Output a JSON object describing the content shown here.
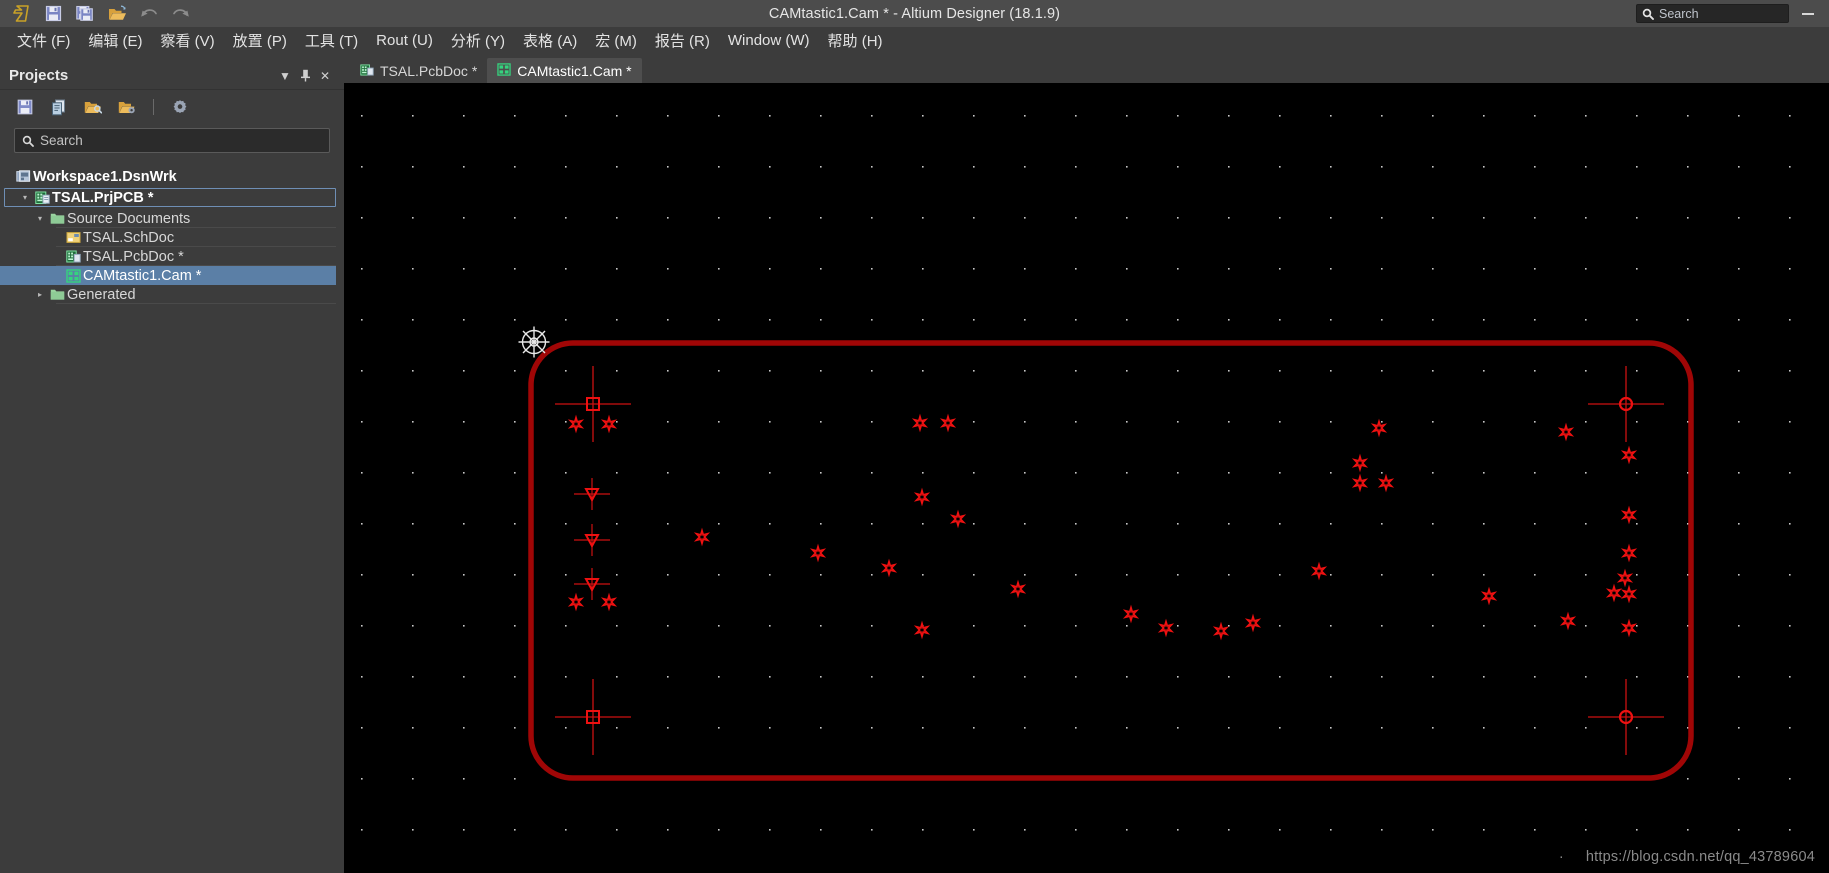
{
  "window": {
    "title": "CAMtastic1.Cam * - Altium Designer (18.1.9)",
    "minimize_label": "–"
  },
  "title_toolbar": {
    "buttons": [
      {
        "name": "altium-logo-icon",
        "label": "Altium"
      },
      {
        "name": "save-icon",
        "label": "Save"
      },
      {
        "name": "save-all-icon",
        "label": "Save All"
      },
      {
        "name": "open-folder-icon",
        "label": "Open"
      },
      {
        "name": "undo-icon",
        "label": "Undo"
      },
      {
        "name": "redo-icon",
        "label": "Redo"
      }
    ]
  },
  "search": {
    "placeholder": "Search",
    "icon": "search-icon"
  },
  "menubar": {
    "items": [
      {
        "label": "文件 (F)",
        "text": "文件",
        "key": "F"
      },
      {
        "label": "编辑 (E)",
        "text": "编辑",
        "key": "E"
      },
      {
        "label": "察看 (V)",
        "text": "察看",
        "key": "V"
      },
      {
        "label": "放置 (P)",
        "text": "放置",
        "key": "P"
      },
      {
        "label": "工具 (T)",
        "text": "工具",
        "key": "T"
      },
      {
        "label": "Rout (U)",
        "text": "Rout",
        "key": "U"
      },
      {
        "label": "分析 (Y)",
        "text": "分析",
        "key": "Y"
      },
      {
        "label": "表格 (A)",
        "text": "表格",
        "key": "A"
      },
      {
        "label": "宏 (M)",
        "text": "宏",
        "key": "M"
      },
      {
        "label": "报告 (R)",
        "text": "报告",
        "key": "R"
      },
      {
        "label": "Window (W)",
        "text": "Window",
        "key": "W"
      },
      {
        "label": "帮助 (H)",
        "text": "帮助",
        "key": "H"
      }
    ]
  },
  "projects_panel": {
    "title": "Projects",
    "header_icons": [
      {
        "name": "chevron-down-icon",
        "glyph": "▼"
      },
      {
        "name": "pin-icon",
        "glyph": "⚑"
      },
      {
        "name": "close-icon",
        "glyph": "✕"
      }
    ],
    "toolbar": [
      {
        "name": "save-project-icon",
        "label": "Save"
      },
      {
        "name": "documents-icon",
        "label": "Documents"
      },
      {
        "name": "open-project-icon",
        "label": "Open Project"
      },
      {
        "name": "project-options-icon",
        "label": "Project Options"
      },
      {
        "name": "panel-settings-icon",
        "label": "Settings"
      }
    ],
    "search": {
      "placeholder": "Search"
    },
    "tree": [
      {
        "label": "Workspace1.DsnWrk",
        "icon": "workspace-icon",
        "indent": 0,
        "expander": "none",
        "style": "root",
        "underline": false
      },
      {
        "label": "TSAL.PrjPCB *",
        "icon": "pcb-project-icon",
        "indent": 1,
        "expander": "open",
        "style": "project-focused",
        "underline": false
      },
      {
        "label": "Source Documents",
        "icon": "folder-icon",
        "indent": 2,
        "expander": "open",
        "style": "normal",
        "underline": true
      },
      {
        "label": "TSAL.SchDoc",
        "icon": "schematic-icon",
        "indent": 3,
        "expander": "none",
        "style": "normal",
        "underline": true
      },
      {
        "label": "TSAL.PcbDoc *",
        "icon": "pcb-doc-icon",
        "indent": 3,
        "expander": "none",
        "style": "normal",
        "underline": true
      },
      {
        "label": "CAMtastic1.Cam *",
        "icon": "cam-doc-icon",
        "indent": 3,
        "expander": "none",
        "style": "selected",
        "underline": false
      },
      {
        "label": "Generated",
        "icon": "folder-icon",
        "indent": 2,
        "expander": "closed",
        "style": "normal",
        "underline": true
      }
    ]
  },
  "document_tabs": [
    {
      "label": "TSAL.PcbDoc *",
      "icon": "pcb-doc-icon",
      "active": false
    },
    {
      "label": "CAMtastic1.Cam *",
      "icon": "cam-doc-icon",
      "active": true
    }
  ],
  "canvas": {
    "background_color": "#000000",
    "grid_dot_color": "#c8c8c8",
    "grid_spacing_px": 51,
    "board_outline_color": "#a00606",
    "pad_color": "#ee1111",
    "crosshair_color": "#cc1111",
    "cursor_color": "#e8e8e8",
    "cursor_name": "cam-wheel-cursor"
  },
  "watermark": {
    "dot": "·",
    "url": "https://blog.csdn.net/qq_43789604"
  }
}
